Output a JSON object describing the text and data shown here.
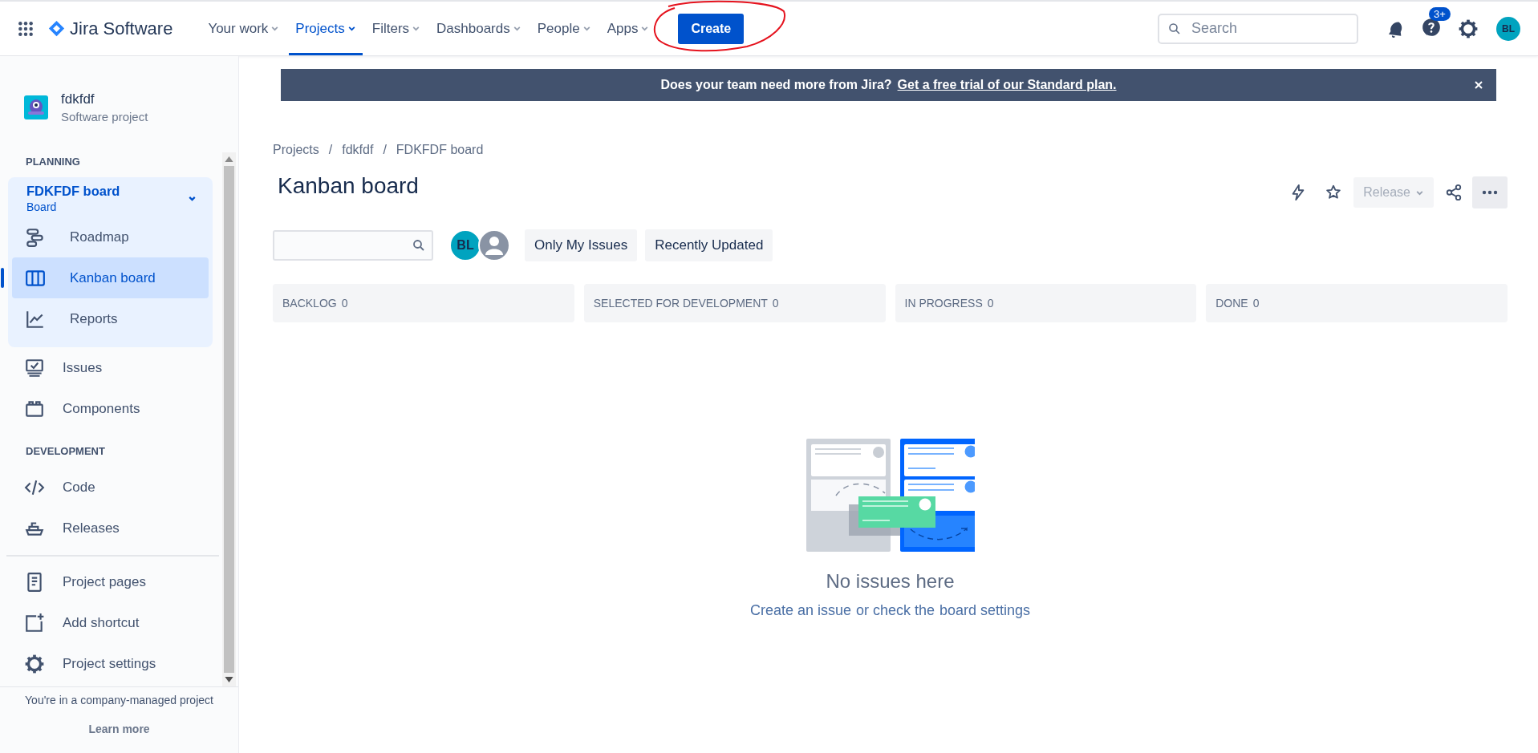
{
  "topbar": {
    "product": "Jira Software",
    "nav": [
      {
        "label": "Your work",
        "selected": false
      },
      {
        "label": "Projects",
        "selected": true
      },
      {
        "label": "Filters",
        "selected": false
      },
      {
        "label": "Dashboards",
        "selected": false
      },
      {
        "label": "People",
        "selected": false
      },
      {
        "label": "Apps",
        "selected": false
      }
    ],
    "create": "Create",
    "search": {
      "placeholder": "Search"
    },
    "help_badge": "3+",
    "avatar": "BL"
  },
  "sidebar": {
    "project": {
      "name": "fdkfdf",
      "type": "Software project"
    },
    "planning": {
      "heading": "PLANNING",
      "board": {
        "title": "FDKFDF board",
        "subtitle": "Board",
        "expanded": true,
        "items": [
          {
            "label": "Roadmap",
            "selected": false
          },
          {
            "label": "Kanban board",
            "selected": true
          },
          {
            "label": "Reports",
            "selected": false
          }
        ]
      },
      "items": [
        "Issues",
        "Components"
      ]
    },
    "development": {
      "heading": "DEVELOPMENT",
      "items": [
        "Code",
        "Releases"
      ]
    },
    "extra": [
      "Project pages",
      "Add shortcut",
      "Project settings"
    ],
    "footer": {
      "text": "You're in a company-managed project",
      "link": "Learn more"
    }
  },
  "banner": {
    "text": "Does your team need more from Jira?",
    "link": "Get a free trial of our Standard plan."
  },
  "board": {
    "breadcrumbs": [
      "Projects",
      "fdkfdf",
      "FDKFDF board"
    ],
    "breadcrumb_separator": "/",
    "title": "Kanban board",
    "release": {
      "label": "Release",
      "disabled": true
    },
    "avatars": [
      "BL"
    ],
    "quick_filters": [
      "Only My Issues",
      "Recently Updated"
    ],
    "columns": [
      {
        "name": "BACKLOG",
        "count": "0"
      },
      {
        "name": "SELECTED FOR DEVELOPMENT",
        "count": "0"
      },
      {
        "name": "IN PROGRESS",
        "count": "0"
      },
      {
        "name": "DONE",
        "count": "0"
      }
    ],
    "empty": {
      "title": "No issues here",
      "link_1": "Create an issue",
      "middle": "or check the",
      "link_2": "board settings"
    }
  }
}
